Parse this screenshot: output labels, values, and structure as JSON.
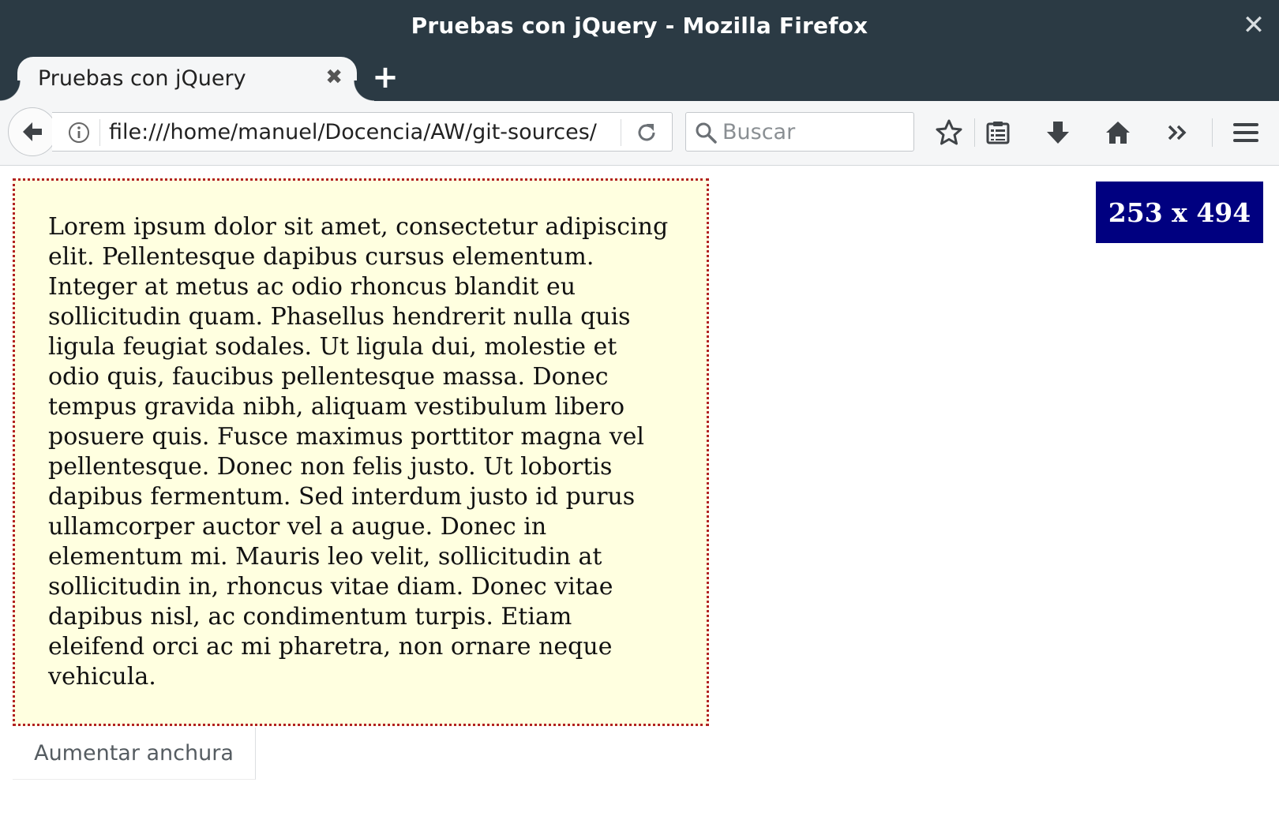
{
  "window": {
    "title": "Pruebas con jQuery - Mozilla Firefox",
    "close_glyph": "✕"
  },
  "tabs": [
    {
      "label": "Pruebas con jQuery",
      "close_glyph": "✖",
      "active": true
    }
  ],
  "newtab_glyph": "+",
  "navbar": {
    "url": "file:///home/manuel/Docencia/AW/git-sources/",
    "search_placeholder": "Buscar",
    "icons": [
      "back-arrow-icon",
      "info-icon",
      "reload-icon",
      "search-icon",
      "bookmark-star-icon",
      "reading-list-icon",
      "download-icon",
      "home-icon",
      "overflow-chevrons-icon",
      "hamburger-menu-icon"
    ]
  },
  "content": {
    "paragraph": "Lorem ipsum dolor sit amet, consectetur adipiscing elit. Pellentesque dapibus cursus elementum. Integer at metus ac odio rhoncus blandit eu sollicitudin quam. Phasellus hendrerit nulla quis ligula feugiat sodales. Ut ligula dui, molestie et odio quis, faucibus pellentesque massa. Donec tempus gravida nibh, aliquam vestibulum libero posuere quis. Fusce maximus porttitor magna vel pellentesque. Donec non felis justo. Ut lobortis dapibus fermentum. Sed interdum justo id purus ullamcorper auctor vel a augue. Donec in elementum mi. Mauris leo velit, sollicitudin at sollicitudin in, rhoncus vitae diam. Donec vitae dapibus nisl, ac condimentum turpis. Etiam eleifend orci ac mi pharetra, non ornare neque vehicula.",
    "size_label": "253 x 494",
    "grow_button": "Aumentar anchura"
  },
  "colors": {
    "chrome_dark": "#2b3a44",
    "toolbar_bg": "#f5f6f7",
    "box_bg": "#ffffe0",
    "box_border": "#b22222",
    "badge_bg": "#000080"
  }
}
